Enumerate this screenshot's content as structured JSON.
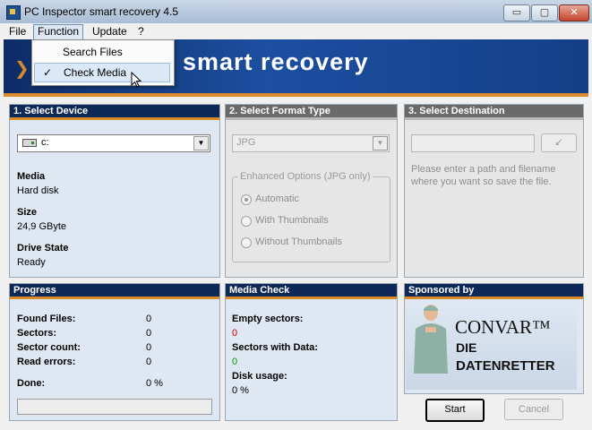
{
  "window": {
    "title": "PC Inspector smart recovery 4.5",
    "minimize": "▭",
    "maximize": "▢",
    "close": "✕"
  },
  "menu": {
    "items": [
      "File",
      "Function",
      "Update",
      "?"
    ]
  },
  "dropdown": {
    "items": [
      "Search Files",
      "Check Media"
    ],
    "checked_mark": "✓"
  },
  "banner": {
    "text": "smart recovery",
    "logo": "❯❯"
  },
  "select_device": {
    "header": "1. Select Device",
    "device_value": "c:",
    "media_label": "Media",
    "media_value": "Hard disk",
    "size_label": "Size",
    "size_value": "24,9 GByte",
    "state_label": "Drive State",
    "state_value": "Ready"
  },
  "format_type": {
    "header": "2. Select Format Type",
    "format_value": "JPG",
    "group_label": "Enhanced Options (JPG only)",
    "options": [
      "Automatic",
      "With Thumbnails",
      "Without Thumbnails"
    ]
  },
  "destination": {
    "header": "3. Select Destination",
    "hint": "Please enter a path and filename where you want so save the file.",
    "browse_icon": "↙"
  },
  "progress": {
    "header": "Progress",
    "rows": [
      {
        "label": "Found Files:",
        "value": "0"
      },
      {
        "label": "Sectors:",
        "value": "0"
      },
      {
        "label": "Sector count:",
        "value": "0"
      },
      {
        "label": "Read errors:",
        "value": "0"
      }
    ],
    "done_label": "Done:",
    "done_value": "0 %",
    "done_fraction": 0
  },
  "media_check": {
    "header": "Media Check",
    "empty_label": "Empty sectors:",
    "empty_value": "0",
    "data_label": "Sectors with Data:",
    "data_value": "0",
    "usage_label": "Disk usage:",
    "usage_value": "0 %"
  },
  "sponsor": {
    "header": "Sponsored by",
    "line1": "CONVAR™",
    "line2": "DIE",
    "line3": "DATENRETTER"
  },
  "buttons": {
    "start": "Start",
    "cancel": "Cancel"
  },
  "colors": {
    "header_bg": "#0e2857",
    "accent": "#d98a2a",
    "red": "#cc0000",
    "green": "#00aa00"
  }
}
